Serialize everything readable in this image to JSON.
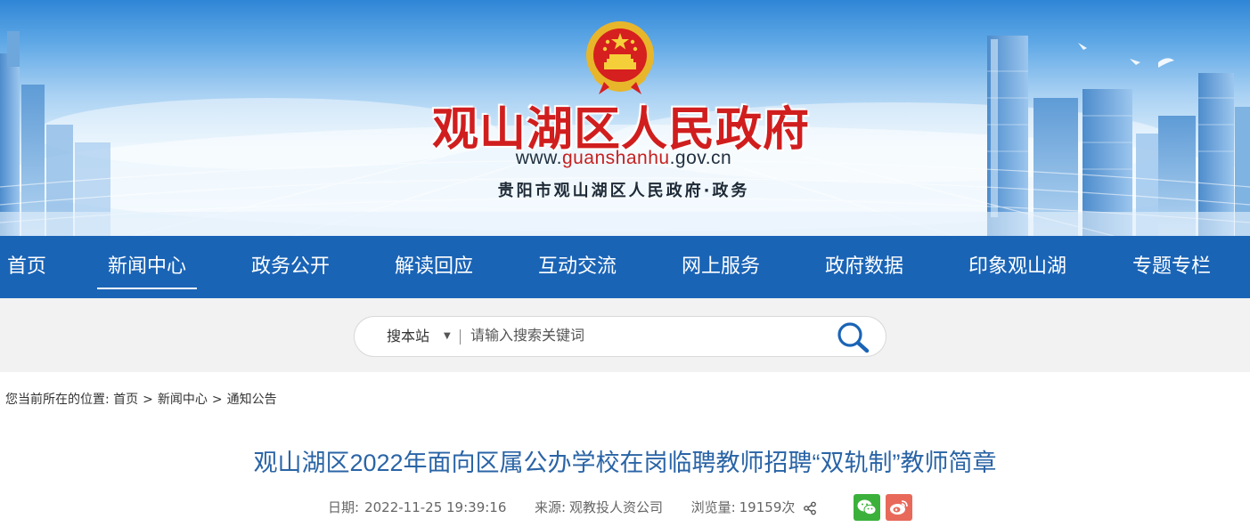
{
  "header": {
    "site_title": "观山湖区人民政府",
    "url_prefix": "www.",
    "url_accent": "guanshanhu",
    "url_suffix": ".gov.cn",
    "subtitle": "贵阳市观山湖区人民政府·政务",
    "emblem_icon": "national-emblem-icon"
  },
  "nav": {
    "items": [
      {
        "label": "首页"
      },
      {
        "label": "新闻中心",
        "active": true
      },
      {
        "label": "政务公开"
      },
      {
        "label": "解读回应"
      },
      {
        "label": "互动交流"
      },
      {
        "label": "网上服务"
      },
      {
        "label": "政府数据"
      },
      {
        "label": "印象观山湖"
      },
      {
        "label": "专题专栏"
      }
    ]
  },
  "search": {
    "scope": "搜本站",
    "scope_arrow": "▼",
    "placeholder": "请输入搜索关键词",
    "button_icon": "search-icon"
  },
  "breadcrumb": {
    "prefix": "您当前所在的位置:",
    "items": [
      "首页",
      "新闻中心",
      "通知公告"
    ],
    "separator": ">"
  },
  "article": {
    "title": "观山湖区2022年面向区属公办学校在岗临聘教师招聘“双轨制”教师简章",
    "date_label": "日期:",
    "date": "2022-11-25 19:39:16",
    "source_label": "来源:",
    "source": "观教投人资公司",
    "views_label": "浏览量:",
    "views": "19159次",
    "share_icon": "share-icon",
    "social": [
      "wechat-icon",
      "weibo-icon"
    ]
  },
  "colors": {
    "nav_bg": "#1a64b6",
    "title_red": "#d01e1e",
    "article_title": "#2a64a6",
    "wechat": "#3bb13b",
    "weibo": "#e8695a"
  }
}
